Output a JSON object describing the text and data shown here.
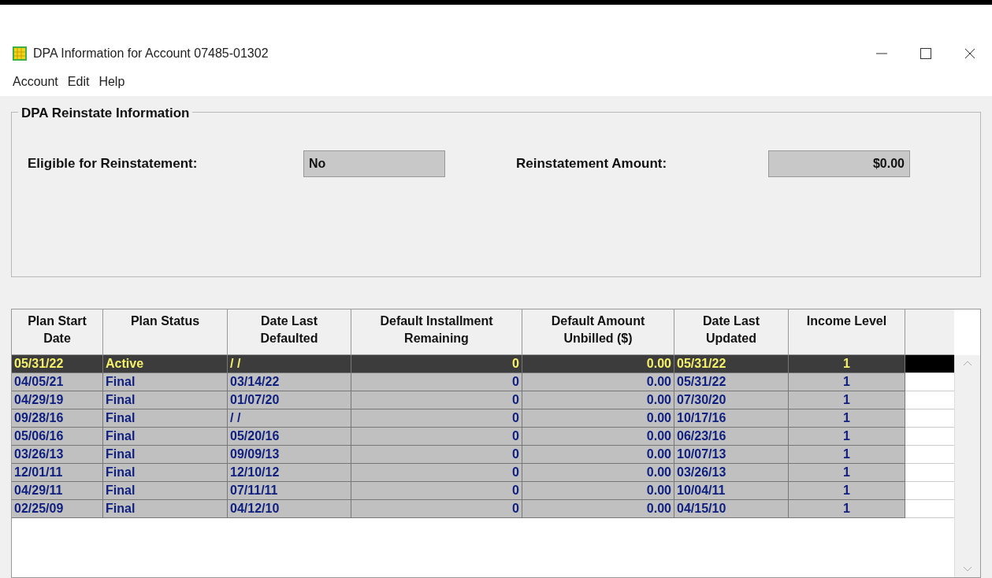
{
  "window": {
    "title": "DPA Information for Account 07485-01302"
  },
  "menu": [
    "Account",
    "Edit",
    "Help"
  ],
  "group": {
    "title": "DPA Reinstate Information",
    "fields": [
      {
        "label": "Eligible for Reinstatement:",
        "value": "No"
      },
      {
        "label": "Reinstatement Amount:",
        "value": "$0.00"
      }
    ]
  },
  "table": {
    "columns": [
      "Plan Start Date",
      "Plan Status",
      "Date Last Defaulted",
      "Default Installment Remaining",
      "Default Amount Unbilled ($)",
      "Date Last Updated",
      "Income Level"
    ],
    "rows": [
      {
        "selected": true,
        "cells": [
          "05/31/22",
          "Active",
          "/ /",
          "0",
          "0.00",
          "05/31/22",
          "1"
        ]
      },
      {
        "selected": false,
        "cells": [
          "04/05/21",
          "Final",
          "03/14/22",
          "0",
          "0.00",
          "05/31/22",
          "1"
        ]
      },
      {
        "selected": false,
        "cells": [
          "04/29/19",
          "Final",
          "01/07/20",
          "0",
          "0.00",
          "07/30/20",
          "1"
        ]
      },
      {
        "selected": false,
        "cells": [
          "09/28/16",
          "Final",
          "/ /",
          "0",
          "0.00",
          "10/17/16",
          "1"
        ]
      },
      {
        "selected": false,
        "cells": [
          "05/06/16",
          "Final",
          "05/20/16",
          "0",
          "0.00",
          "06/23/16",
          "1"
        ]
      },
      {
        "selected": false,
        "cells": [
          "03/26/13",
          "Final",
          "09/09/13",
          "0",
          "0.00",
          "10/07/13",
          "1"
        ]
      },
      {
        "selected": false,
        "cells": [
          "12/01/11",
          "Final",
          "12/10/12",
          "0",
          "0.00",
          "03/26/13",
          "1"
        ]
      },
      {
        "selected": false,
        "cells": [
          "04/29/11",
          "Final",
          "07/11/11",
          "0",
          "0.00",
          "10/04/11",
          "1"
        ]
      },
      {
        "selected": false,
        "cells": [
          "02/25/09",
          "Final",
          "04/12/10",
          "0",
          "0.00",
          "04/15/10",
          "1"
        ]
      }
    ]
  }
}
